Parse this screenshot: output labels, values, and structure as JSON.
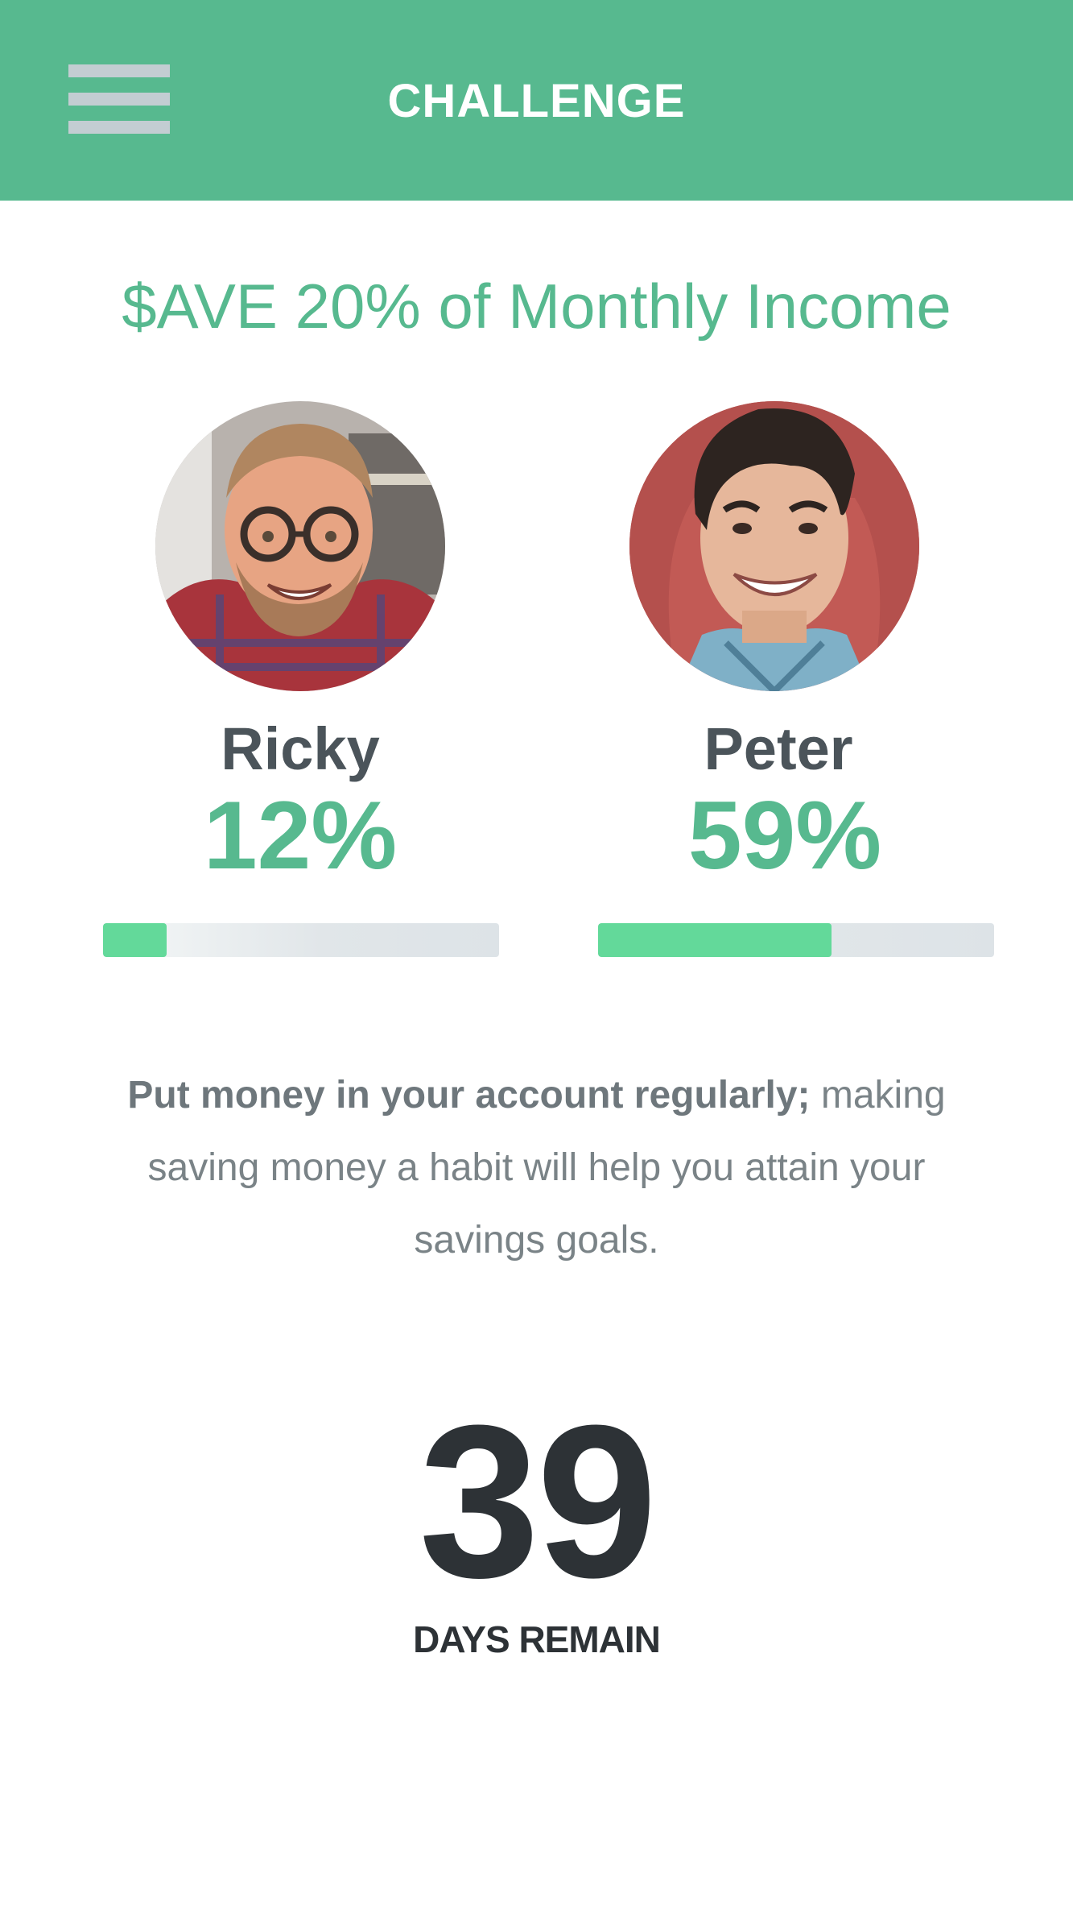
{
  "header": {
    "title": "CHALLENGE",
    "menu_icon": "hamburger-menu-icon",
    "background_color": "#57b98f"
  },
  "challenge": {
    "title": "$AVE 20% of Monthly Income"
  },
  "participants": [
    {
      "name": "Ricky",
      "percent_label": "12%",
      "progress": 0.16,
      "avatar": "photo of smiling man with glasses and beard"
    },
    {
      "name": "Peter",
      "percent_label": "59%",
      "progress": 0.59,
      "avatar": "photo of smiling man with dark hair"
    }
  ],
  "tip": {
    "bold": "Put money in your account regularly;",
    "text": " making saving money a habit will help you attain your savings goals."
  },
  "countdown": {
    "value": "39",
    "label": "DAYS REMAIN"
  },
  "colors": {
    "accent": "#57b98f",
    "progress_fill": "#63d99a",
    "text_dark": "#2d3236"
  }
}
